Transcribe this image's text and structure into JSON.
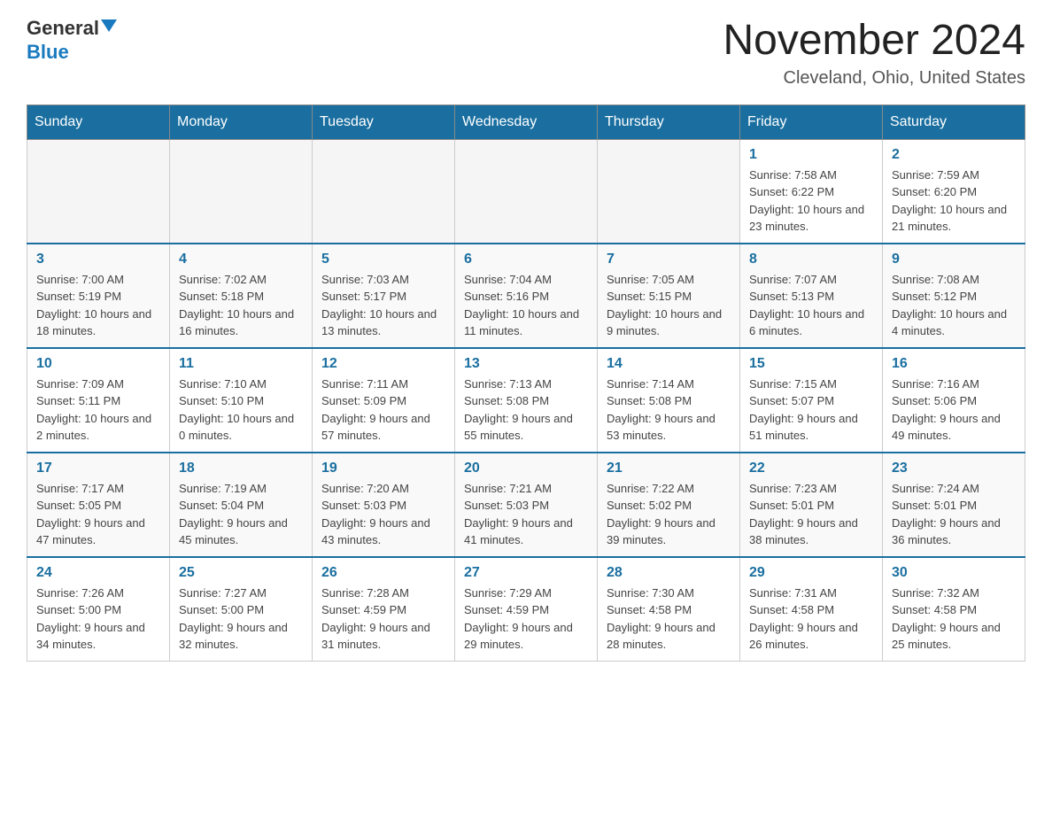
{
  "header": {
    "logo_general": "General",
    "logo_blue": "Blue",
    "month_title": "November 2024",
    "location": "Cleveland, Ohio, United States"
  },
  "weekdays": [
    "Sunday",
    "Monday",
    "Tuesday",
    "Wednesday",
    "Thursday",
    "Friday",
    "Saturday"
  ],
  "weeks": [
    [
      {
        "day": "",
        "info": ""
      },
      {
        "day": "",
        "info": ""
      },
      {
        "day": "",
        "info": ""
      },
      {
        "day": "",
        "info": ""
      },
      {
        "day": "",
        "info": ""
      },
      {
        "day": "1",
        "info": "Sunrise: 7:58 AM\nSunset: 6:22 PM\nDaylight: 10 hours and 23 minutes."
      },
      {
        "day": "2",
        "info": "Sunrise: 7:59 AM\nSunset: 6:20 PM\nDaylight: 10 hours and 21 minutes."
      }
    ],
    [
      {
        "day": "3",
        "info": "Sunrise: 7:00 AM\nSunset: 5:19 PM\nDaylight: 10 hours and 18 minutes."
      },
      {
        "day": "4",
        "info": "Sunrise: 7:02 AM\nSunset: 5:18 PM\nDaylight: 10 hours and 16 minutes."
      },
      {
        "day": "5",
        "info": "Sunrise: 7:03 AM\nSunset: 5:17 PM\nDaylight: 10 hours and 13 minutes."
      },
      {
        "day": "6",
        "info": "Sunrise: 7:04 AM\nSunset: 5:16 PM\nDaylight: 10 hours and 11 minutes."
      },
      {
        "day": "7",
        "info": "Sunrise: 7:05 AM\nSunset: 5:15 PM\nDaylight: 10 hours and 9 minutes."
      },
      {
        "day": "8",
        "info": "Sunrise: 7:07 AM\nSunset: 5:13 PM\nDaylight: 10 hours and 6 minutes."
      },
      {
        "day": "9",
        "info": "Sunrise: 7:08 AM\nSunset: 5:12 PM\nDaylight: 10 hours and 4 minutes."
      }
    ],
    [
      {
        "day": "10",
        "info": "Sunrise: 7:09 AM\nSunset: 5:11 PM\nDaylight: 10 hours and 2 minutes."
      },
      {
        "day": "11",
        "info": "Sunrise: 7:10 AM\nSunset: 5:10 PM\nDaylight: 10 hours and 0 minutes."
      },
      {
        "day": "12",
        "info": "Sunrise: 7:11 AM\nSunset: 5:09 PM\nDaylight: 9 hours and 57 minutes."
      },
      {
        "day": "13",
        "info": "Sunrise: 7:13 AM\nSunset: 5:08 PM\nDaylight: 9 hours and 55 minutes."
      },
      {
        "day": "14",
        "info": "Sunrise: 7:14 AM\nSunset: 5:08 PM\nDaylight: 9 hours and 53 minutes."
      },
      {
        "day": "15",
        "info": "Sunrise: 7:15 AM\nSunset: 5:07 PM\nDaylight: 9 hours and 51 minutes."
      },
      {
        "day": "16",
        "info": "Sunrise: 7:16 AM\nSunset: 5:06 PM\nDaylight: 9 hours and 49 minutes."
      }
    ],
    [
      {
        "day": "17",
        "info": "Sunrise: 7:17 AM\nSunset: 5:05 PM\nDaylight: 9 hours and 47 minutes."
      },
      {
        "day": "18",
        "info": "Sunrise: 7:19 AM\nSunset: 5:04 PM\nDaylight: 9 hours and 45 minutes."
      },
      {
        "day": "19",
        "info": "Sunrise: 7:20 AM\nSunset: 5:03 PM\nDaylight: 9 hours and 43 minutes."
      },
      {
        "day": "20",
        "info": "Sunrise: 7:21 AM\nSunset: 5:03 PM\nDaylight: 9 hours and 41 minutes."
      },
      {
        "day": "21",
        "info": "Sunrise: 7:22 AM\nSunset: 5:02 PM\nDaylight: 9 hours and 39 minutes."
      },
      {
        "day": "22",
        "info": "Sunrise: 7:23 AM\nSunset: 5:01 PM\nDaylight: 9 hours and 38 minutes."
      },
      {
        "day": "23",
        "info": "Sunrise: 7:24 AM\nSunset: 5:01 PM\nDaylight: 9 hours and 36 minutes."
      }
    ],
    [
      {
        "day": "24",
        "info": "Sunrise: 7:26 AM\nSunset: 5:00 PM\nDaylight: 9 hours and 34 minutes."
      },
      {
        "day": "25",
        "info": "Sunrise: 7:27 AM\nSunset: 5:00 PM\nDaylight: 9 hours and 32 minutes."
      },
      {
        "day": "26",
        "info": "Sunrise: 7:28 AM\nSunset: 4:59 PM\nDaylight: 9 hours and 31 minutes."
      },
      {
        "day": "27",
        "info": "Sunrise: 7:29 AM\nSunset: 4:59 PM\nDaylight: 9 hours and 29 minutes."
      },
      {
        "day": "28",
        "info": "Sunrise: 7:30 AM\nSunset: 4:58 PM\nDaylight: 9 hours and 28 minutes."
      },
      {
        "day": "29",
        "info": "Sunrise: 7:31 AM\nSunset: 4:58 PM\nDaylight: 9 hours and 26 minutes."
      },
      {
        "day": "30",
        "info": "Sunrise: 7:32 AM\nSunset: 4:58 PM\nDaylight: 9 hours and 25 minutes."
      }
    ]
  ]
}
